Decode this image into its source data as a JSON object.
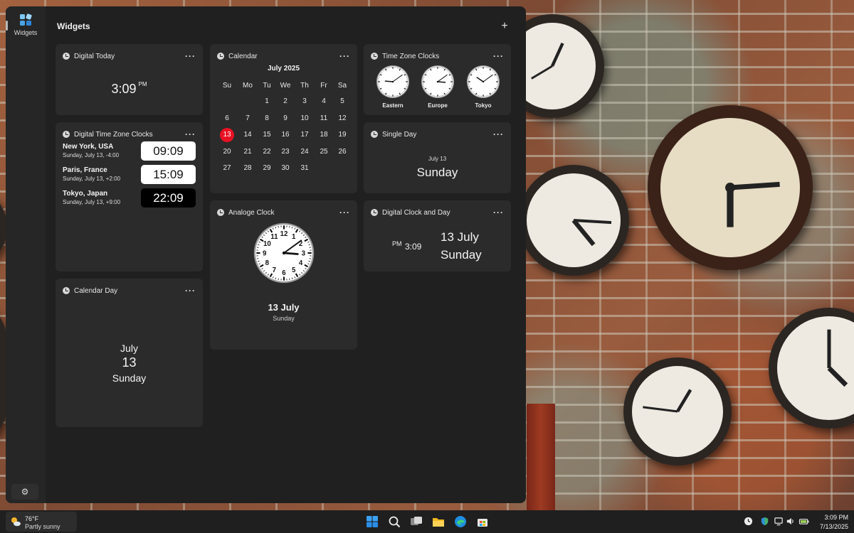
{
  "rail": {
    "widgets_label": "Widgets",
    "settings_icon": "gear-icon"
  },
  "board": {
    "title": "Widgets",
    "add_label": "+"
  },
  "more_label": "···",
  "digital_today": {
    "title": "Digital Today",
    "time": "3:09",
    "ampm": "PM"
  },
  "digital_tz": {
    "title": "Digital Time Zone Clocks",
    "rows": [
      {
        "city": "New York, USA",
        "date": "Sunday, July 13, -4:00",
        "time": "09:09"
      },
      {
        "city": "Paris, France",
        "date": "Sunday, July 13, +2:00",
        "time": "15:09"
      },
      {
        "city": "Tokyo, Japan",
        "date": "Sunday, July 13, +9:00",
        "time": "22:09"
      }
    ]
  },
  "calendar_day": {
    "title": "Calendar Day",
    "month": "July",
    "day": "13",
    "weekday": "Sunday"
  },
  "calendar": {
    "title": "Calendar",
    "month_label": "July 2025",
    "weekdays": [
      "Su",
      "Mo",
      "Tu",
      "We",
      "Th",
      "Fr",
      "Sa"
    ],
    "first_weekday_index": 2,
    "days_in_month": 31,
    "today": 13,
    "today_color": "#e81123"
  },
  "analog_clock": {
    "title": "Analoge Clock",
    "date": "13 July",
    "weekday": "Sunday",
    "hours": 3,
    "minutes": 9
  },
  "tz_clocks": {
    "title": "Time Zone Clocks",
    "clocks": [
      {
        "label": "Eastern",
        "hours": 9,
        "minutes": 9
      },
      {
        "label": "Europe",
        "hours": 15,
        "minutes": 9
      },
      {
        "label": "Tokyo",
        "hours": 22,
        "minutes": 9
      }
    ]
  },
  "single_day": {
    "title": "Single Day",
    "date": "July 13",
    "weekday": "Sunday"
  },
  "digital_clock_day": {
    "title": "Digital Clock and Day",
    "ampm": "PM",
    "time": "3:09",
    "date": "13 July",
    "weekday": "Sunday"
  },
  "taskbar": {
    "weather_temp": "76°F",
    "weather_condition": "Partly sunny",
    "apps": [
      "windows-start-icon",
      "search-icon",
      "task-view-icon",
      "file-explorer-icon",
      "edge-browser-icon",
      "store-icon"
    ],
    "clock_time": "3:09 PM",
    "clock_date": "7/13/2025"
  }
}
